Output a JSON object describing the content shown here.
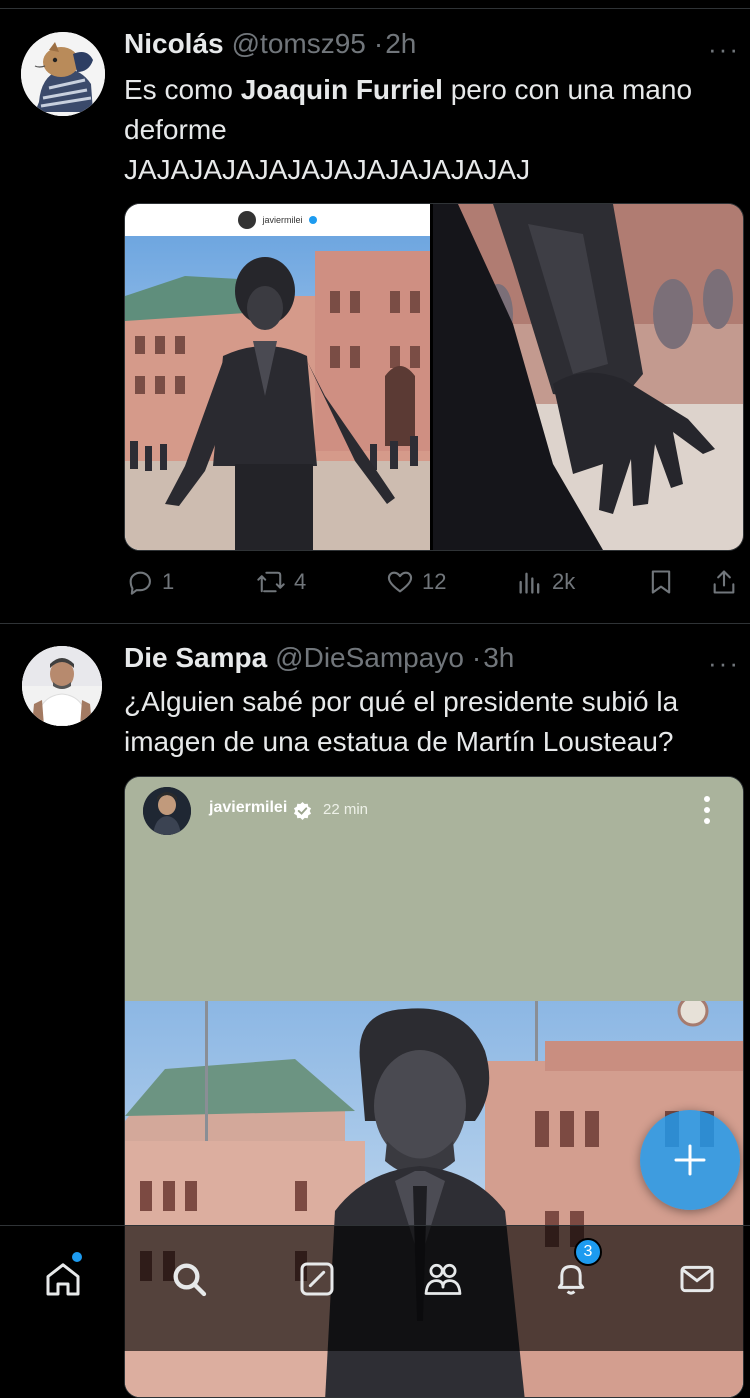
{
  "posts": [
    {
      "name": "Nicolás",
      "handle": "@tomsz95",
      "separator": "·",
      "time": "2h",
      "more": "···",
      "text_before": "Es como ",
      "text_bold": "Joaquin Furriel",
      "text_after": " pero con una mano\ndeforme\nJAJAJAJAJAJAJAJAJAJAJAJAJ",
      "embed": {
        "account": "javiermilei"
      },
      "actions": {
        "replies": "1",
        "reposts": "4",
        "likes": "12",
        "views": "2k"
      }
    },
    {
      "name": "Die Sampa",
      "handle": "@DieSampayo",
      "separator": "·",
      "time": "3h",
      "more": "···",
      "text": "¿Alguien sabé por qué el presidente subió la\nimagen de una estatua de Martín Lousteau?",
      "embed": {
        "account": "javiermilei",
        "time": "22 min"
      }
    }
  ],
  "fab": {
    "icon": "plus-icon",
    "label": "+"
  },
  "nav": {
    "notifications_badge": "3",
    "items": [
      "home-icon",
      "search-icon",
      "compose-icon",
      "communities-icon",
      "notifications-icon",
      "messages-icon"
    ]
  },
  "colors": {
    "accent": "#1d9bf0",
    "muted": "#71767b",
    "text": "#e7e9ea",
    "divider": "#2f3336"
  }
}
